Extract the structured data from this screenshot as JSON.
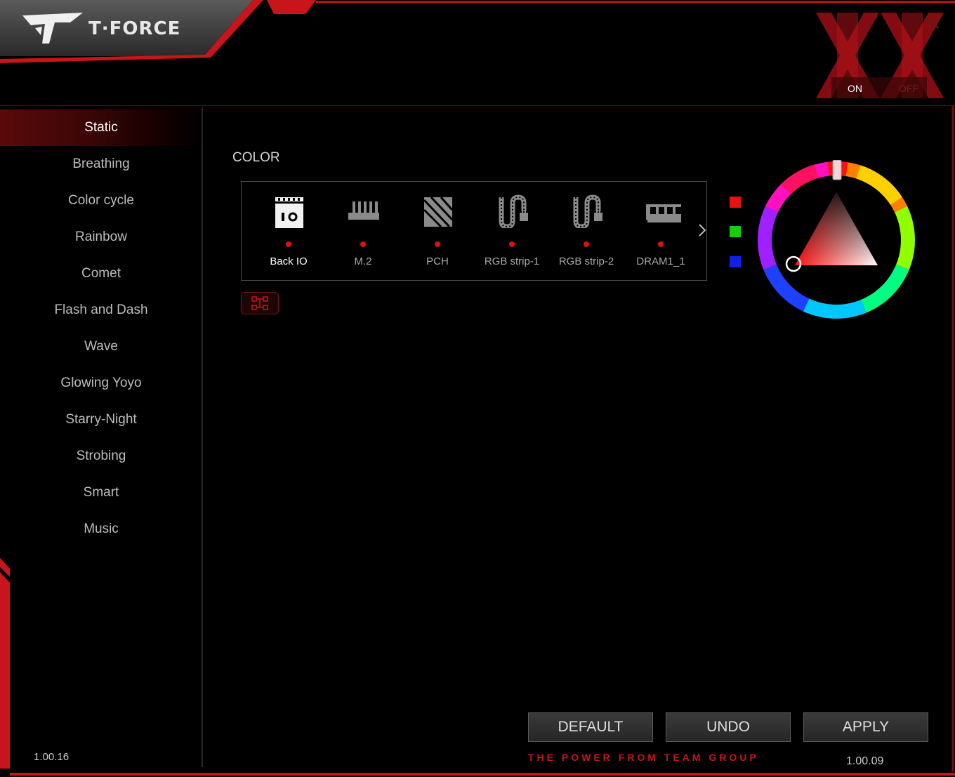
{
  "app": {
    "logo_text": "T·FORCE"
  },
  "colors": {
    "accent": "#c8141b",
    "active_bg": "#5a0a0a",
    "background": "#000000",
    "selected_color": "#ff0000"
  },
  "power_toggle": {
    "on_label": "ON",
    "off_label": "OFF",
    "state": "ON"
  },
  "sidebar": {
    "items": [
      {
        "label": "Static",
        "active": true
      },
      {
        "label": "Breathing"
      },
      {
        "label": "Color cycle"
      },
      {
        "label": "Rainbow"
      },
      {
        "label": "Comet"
      },
      {
        "label": "Flash and Dash"
      },
      {
        "label": "Wave"
      },
      {
        "label": "Glowing Yoyo"
      },
      {
        "label": "Starry-Night"
      },
      {
        "label": "Strobing"
      },
      {
        "label": "Smart"
      },
      {
        "label": "Music"
      }
    ]
  },
  "main": {
    "section_label": "COLOR",
    "devices": [
      {
        "label": "Back IO",
        "icon": "back-io-icon",
        "selected": true
      },
      {
        "label": "M.2",
        "icon": "m2-icon"
      },
      {
        "label": "PCH",
        "icon": "pch-icon"
      },
      {
        "label": "RGB strip-1",
        "icon": "rgb-strip-icon"
      },
      {
        "label": "RGB strip-2",
        "icon": "rgb-strip-icon"
      },
      {
        "label": "DRAM1_1",
        "icon": "dram-icon"
      }
    ],
    "swatches": [
      "#e81010",
      "#10d010",
      "#1020e8"
    ]
  },
  "footer": {
    "default_label": "DEFAULT",
    "undo_label": "UNDO",
    "apply_label": "APPLY",
    "tagline": "THE POWER FROM TEAM GROUP",
    "version_left": "1.00.16",
    "version_right": "1.00.09"
  }
}
